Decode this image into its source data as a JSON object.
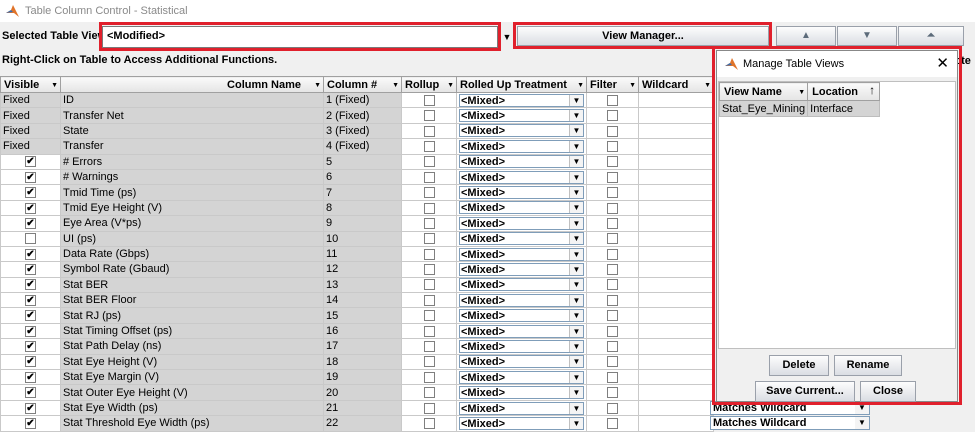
{
  "window": {
    "title": "Table Column Control - Statistical"
  },
  "toolbar": {
    "selected_view_label": "Selected Table View:",
    "selected_view_value": "<Modified>",
    "view_manager_label": "View Manager...",
    "hint": "Right-Click on Table to Access Additional Functions.",
    "cut_label": "cte"
  },
  "table": {
    "headers": [
      "Visible",
      "Column Name",
      "Column #",
      "Rollup",
      "Rolled Up Treatment",
      "Filter",
      "Wildcard"
    ],
    "rows": [
      {
        "visible": "Fixed",
        "name": "ID",
        "num": "1  (Fixed)",
        "treatment": "<Mixed>"
      },
      {
        "visible": "Fixed",
        "name": "Transfer Net",
        "num": "2  (Fixed)",
        "treatment": "<Mixed>"
      },
      {
        "visible": "Fixed",
        "name": "State",
        "num": "3  (Fixed)",
        "treatment": "<Mixed>"
      },
      {
        "visible": "Fixed",
        "name": "Transfer",
        "num": "4  (Fixed)",
        "treatment": "<Mixed>"
      },
      {
        "visible": "check",
        "name": "# Errors",
        "num": "5",
        "treatment": "<Mixed>"
      },
      {
        "visible": "check",
        "name": "# Warnings",
        "num": "6",
        "treatment": "<Mixed>"
      },
      {
        "visible": "check",
        "name": "Tmid Time (ps)",
        "num": "7",
        "treatment": "<Mixed>"
      },
      {
        "visible": "check",
        "name": "Tmid Eye Height (V)",
        "num": "8",
        "treatment": "<Mixed>"
      },
      {
        "visible": "check",
        "name": "Eye Area (V*ps)",
        "num": "9",
        "treatment": "<Mixed>"
      },
      {
        "visible": "uncheck",
        "name": "UI (ps)",
        "num": "10",
        "treatment": "<Mixed>"
      },
      {
        "visible": "check",
        "name": "Data Rate (Gbps)",
        "num": "11",
        "treatment": "<Mixed>"
      },
      {
        "visible": "check",
        "name": "Symbol Rate (Gbaud)",
        "num": "12",
        "treatment": "<Mixed>"
      },
      {
        "visible": "check",
        "name": "Stat BER",
        "num": "13",
        "treatment": "<Mixed>"
      },
      {
        "visible": "check",
        "name": "Stat BER Floor",
        "num": "14",
        "treatment": "<Mixed>"
      },
      {
        "visible": "check",
        "name": "Stat RJ (ps)",
        "num": "15",
        "treatment": "<Mixed>"
      },
      {
        "visible": "check",
        "name": "Stat Timing Offset (ps)",
        "num": "16",
        "treatment": "<Mixed>"
      },
      {
        "visible": "check",
        "name": "Stat Path Delay (ns)",
        "num": "17",
        "treatment": "<Mixed>"
      },
      {
        "visible": "check",
        "name": "Stat Eye Height (V)",
        "num": "18",
        "treatment": "<Mixed>"
      },
      {
        "visible": "check",
        "name": "Stat Eye Margin (V)",
        "num": "19",
        "treatment": "<Mixed>"
      },
      {
        "visible": "check",
        "name": "Stat Outer Eye Height (V)",
        "num": "20",
        "treatment": "<Mixed>"
      },
      {
        "visible": "check",
        "name": "Stat Eye Width (ps)",
        "num": "21",
        "treatment": "<Mixed>"
      },
      {
        "visible": "check",
        "name": "Stat Threshold Eye Width (ps)",
        "num": "22",
        "treatment": "<Mixed>"
      }
    ],
    "wildcard_values": [
      "Matches Wildcard",
      "Matches Wildcard"
    ]
  },
  "dialog": {
    "title": "Manage Table Views",
    "headers": [
      "View Name",
      "Location"
    ],
    "rows": [
      {
        "name": "Stat_Eye_Mining",
        "location": "Interface"
      }
    ],
    "delete_label": "Delete",
    "rename_label": "Rename",
    "save_current_label": "Save Current...",
    "close_label": "Close"
  },
  "colors": {
    "highlight_red": "#e0202c",
    "fixed_gray": "#d4d4d4"
  },
  "icons": [
    "matlab-icon",
    "close-icon",
    "sort-arrow-icon",
    "dropdown-arrow-icon",
    "up-arrow-icon",
    "down-arrow-icon",
    "top-arrow-icon"
  ]
}
